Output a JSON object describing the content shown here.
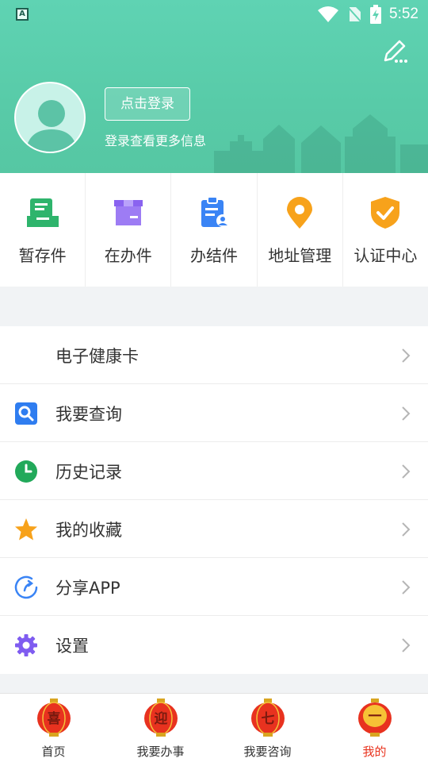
{
  "status_bar": {
    "app_icon": "A",
    "time": "5:52",
    "icons": [
      "wifi-icon",
      "no-sim-icon",
      "battery-charging-icon"
    ]
  },
  "header": {
    "login_button": "点击登录",
    "login_hint": "登录查看更多信息",
    "edit_icon": "edit-icon",
    "colors": {
      "background": "#5ccfaf"
    }
  },
  "quick_actions": [
    {
      "label": "暂存件",
      "icon": "draft-box-icon",
      "color": "#2eb46c"
    },
    {
      "label": "在办件",
      "icon": "box-icon",
      "color": "#8a63f0"
    },
    {
      "label": "办结件",
      "icon": "clipboard-user-icon",
      "color": "#3a84f5"
    },
    {
      "label": "地址管理",
      "icon": "location-pin-icon",
      "color": "#f7a21b"
    },
    {
      "label": "认证中心",
      "icon": "shield-check-icon",
      "color": "#f7a21b"
    }
  ],
  "menu": [
    {
      "label": "电子健康卡",
      "icon": ""
    },
    {
      "label": "我要查询",
      "icon": "search-icon"
    },
    {
      "label": "历史记录",
      "icon": "clock-icon"
    },
    {
      "label": "我的收藏",
      "icon": "star-icon"
    },
    {
      "label": "分享APP",
      "icon": "share-icon"
    },
    {
      "label": "设置",
      "icon": "gear-icon"
    }
  ],
  "bottom_nav": [
    {
      "label": "首页",
      "lantern_char": "喜",
      "active": false
    },
    {
      "label": "我要办事",
      "lantern_char": "迎",
      "active": false
    },
    {
      "label": "我要咨询",
      "lantern_char": "七",
      "active": false
    },
    {
      "label": "我的",
      "lantern_char": "一",
      "active": true
    }
  ],
  "active_color": "#e9341f"
}
